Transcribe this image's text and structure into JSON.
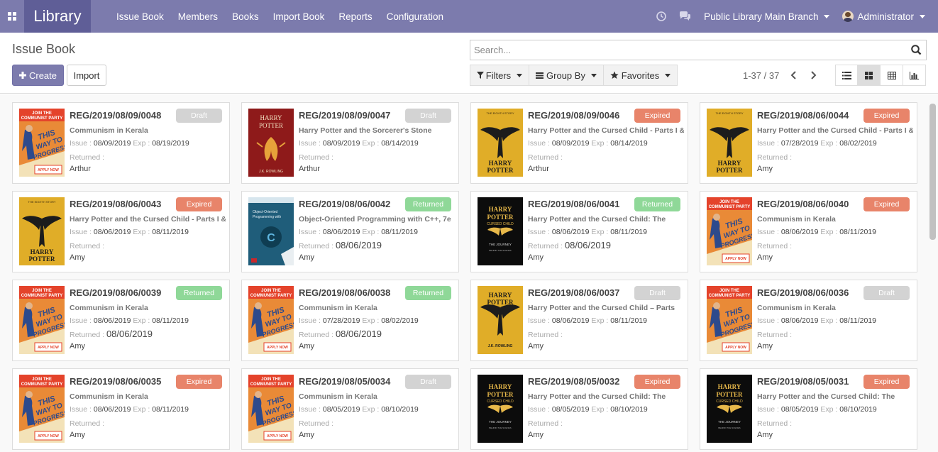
{
  "app": {
    "title": "Library"
  },
  "menu": [
    "Issue Book",
    "Members",
    "Books",
    "Import Book",
    "Reports",
    "Configuration"
  ],
  "navbar": {
    "branch": "Public Library Main Branch",
    "user": "Administrator"
  },
  "page": {
    "title": "Issue Book"
  },
  "actions": {
    "create": "Create",
    "import": "Import"
  },
  "search": {
    "placeholder": "Search..."
  },
  "filters": {
    "filters": "Filters",
    "group_by": "Group By",
    "favorites": "Favorites"
  },
  "pager": {
    "value": "1-37 / 37"
  },
  "labels": {
    "issue": "Issue :",
    "exp": "Exp :",
    "returned": "Returned :"
  },
  "status_colors": {
    "Draft": "#d3d3d3",
    "Expired": "#e8846a",
    "Returned": "#8fd898"
  },
  "cards": [
    {
      "ref": "REG/2019/08/09/0048",
      "status": "Draft",
      "book": "Communism in Kerala",
      "issue": "08/09/2019",
      "exp": "08/19/2019",
      "returned": "",
      "member": "Arthur",
      "cover": "communist"
    },
    {
      "ref": "REG/2019/08/09/0047",
      "status": "Draft",
      "book": "Harry Potter and the Sorcerer's Stone",
      "issue": "08/09/2019",
      "exp": "08/14/2019",
      "returned": "",
      "member": "Arthur",
      "cover": "hp-red"
    },
    {
      "ref": "REG/2019/08/09/0046",
      "status": "Expired",
      "book": "Harry Potter and the Cursed Child - Parts I &",
      "issue": "08/09/2019",
      "exp": "08/14/2019",
      "returned": "",
      "member": "Arthur",
      "cover": "hp-gold"
    },
    {
      "ref": "REG/2019/08/06/0044",
      "status": "Expired",
      "book": "Harry Potter and the Cursed Child - Parts I &",
      "issue": "07/28/2019",
      "exp": "08/02/2019",
      "returned": "",
      "member": "Amy",
      "cover": "hp-gold"
    },
    {
      "ref": "REG/2019/08/06/0043",
      "status": "Expired",
      "book": "Harry Potter and the Cursed Child - Parts I &",
      "issue": "08/06/2019",
      "exp": "08/11/2019",
      "returned": "",
      "member": "Amy",
      "cover": "hp-gold"
    },
    {
      "ref": "REG/2019/08/06/0042",
      "status": "Returned",
      "book": "Object-Oriented Programming with C++, 7e",
      "issue": "08/06/2019",
      "exp": "08/11/2019",
      "returned": "08/06/2019",
      "member": "Amy",
      "cover": "oop"
    },
    {
      "ref": "REG/2019/08/06/0041",
      "status": "Returned",
      "book": "Harry Potter and the Cursed Child: The",
      "issue": "08/06/2019",
      "exp": "08/11/2019",
      "returned": "08/06/2019",
      "member": "Amy",
      "cover": "hp-black"
    },
    {
      "ref": "REG/2019/08/06/0040",
      "status": "Expired",
      "book": "Communism in Kerala",
      "issue": "08/06/2019",
      "exp": "08/11/2019",
      "returned": "",
      "member": "Amy",
      "cover": "communist"
    },
    {
      "ref": "REG/2019/08/06/0039",
      "status": "Returned",
      "book": "Communism in Kerala",
      "issue": "08/06/2019",
      "exp": "08/11/2019",
      "returned": "08/06/2019",
      "member": "Amy",
      "cover": "communist"
    },
    {
      "ref": "REG/2019/08/06/0038",
      "status": "Returned",
      "book": "Communism in Kerala",
      "issue": "07/28/2019",
      "exp": "08/02/2019",
      "returned": "08/06/2019",
      "member": "Amy",
      "cover": "communist"
    },
    {
      "ref": "REG/2019/08/06/0037",
      "status": "Draft",
      "book": "Harry Potter and the Cursed Child – Parts",
      "issue": "08/06/2019",
      "exp": "08/11/2019",
      "returned": "",
      "member": "Amy",
      "cover": "hp-gold2"
    },
    {
      "ref": "REG/2019/08/06/0036",
      "status": "Draft",
      "book": "Communism in Kerala",
      "issue": "08/06/2019",
      "exp": "08/11/2019",
      "returned": "",
      "member": "Amy",
      "cover": "communist"
    },
    {
      "ref": "REG/2019/08/06/0035",
      "status": "Expired",
      "book": "Communism in Kerala",
      "issue": "08/06/2019",
      "exp": "08/11/2019",
      "returned": "",
      "member": "Amy",
      "cover": "communist"
    },
    {
      "ref": "REG/2019/08/05/0034",
      "status": "Draft",
      "book": "Communism in Kerala",
      "issue": "08/05/2019",
      "exp": "08/10/2019",
      "returned": "",
      "member": "Amy",
      "cover": "communist"
    },
    {
      "ref": "REG/2019/08/05/0032",
      "status": "Expired",
      "book": "Harry Potter and the Cursed Child: The",
      "issue": "08/05/2019",
      "exp": "08/10/2019",
      "returned": "",
      "member": "Amy",
      "cover": "hp-black"
    },
    {
      "ref": "REG/2019/08/05/0031",
      "status": "Expired",
      "book": "Harry Potter and the Cursed Child: The",
      "issue": "08/05/2019",
      "exp": "08/10/2019",
      "returned": "",
      "member": "Amy",
      "cover": "hp-black"
    }
  ]
}
